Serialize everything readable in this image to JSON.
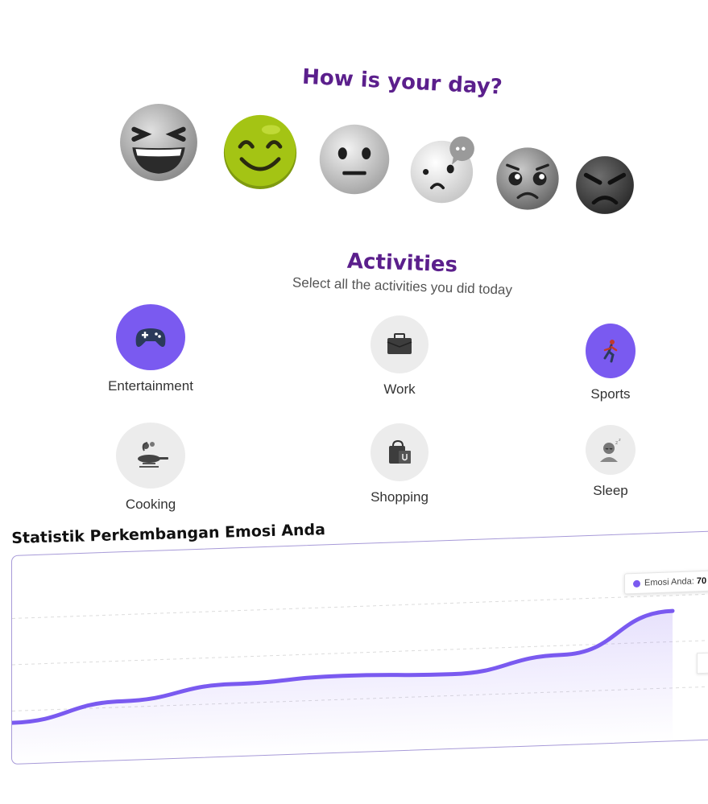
{
  "mood": {
    "title": "How is your day?",
    "options": [
      {
        "name": "laughing",
        "selected": false
      },
      {
        "name": "happy",
        "selected": true
      },
      {
        "name": "neutral",
        "selected": false
      },
      {
        "name": "worried",
        "selected": false
      },
      {
        "name": "sad",
        "selected": false
      },
      {
        "name": "angry",
        "selected": false
      }
    ],
    "accent_color": "#a4c414"
  },
  "activities": {
    "title": "Activities",
    "subtitle": "Select all the activities you did today",
    "accent_color": "#7a5af0",
    "items": [
      {
        "label": "Entertainment",
        "icon": "gamepad-icon",
        "selected": true
      },
      {
        "label": "Work",
        "icon": "briefcase-icon",
        "selected": false
      },
      {
        "label": "Sports",
        "icon": "runner-icon",
        "selected": true
      },
      {
        "label": "Cooking",
        "icon": "cooking-pan-icon",
        "selected": false
      },
      {
        "label": "Shopping",
        "icon": "shopping-bag-icon",
        "selected": false
      },
      {
        "label": "Sleep",
        "icon": "sleeping-person-icon",
        "selected": false
      }
    ]
  },
  "statistics": {
    "title": "Statistik Perkembangan Emosi Anda",
    "tooltip": {
      "series": "Emosi Anda:",
      "value": "70"
    }
  },
  "chart_data": {
    "type": "area",
    "series": [
      {
        "name": "Emosi Anda",
        "values": [
          30,
          38,
          44,
          46,
          45,
          52,
          70
        ]
      }
    ],
    "ylim": [
      0,
      100
    ],
    "color": "#7a5af0",
    "grid": true
  }
}
